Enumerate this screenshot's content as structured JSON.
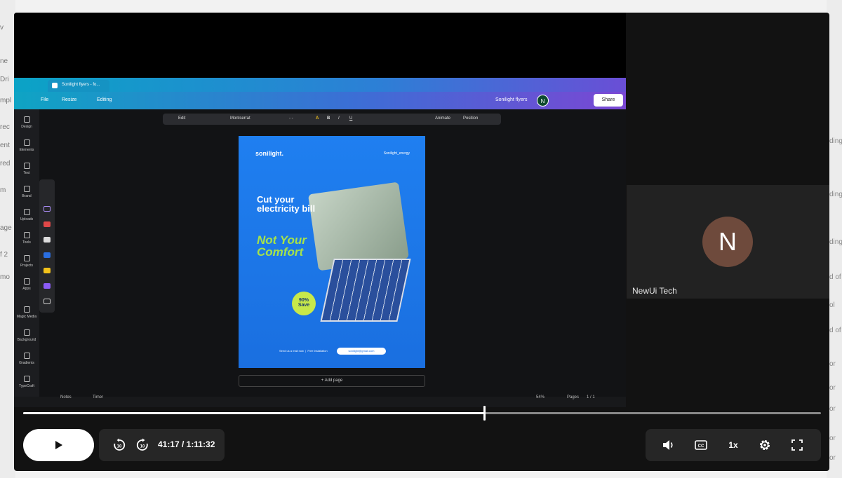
{
  "background": {
    "left_fragments": [
      "v",
      "ne",
      "Dri",
      "mpl",
      "rec",
      "ent",
      "red",
      "m",
      "age",
      "f 2",
      "mo"
    ],
    "right_fragments": [
      "ding",
      "ding",
      "ding",
      "d of",
      "ol",
      "d of",
      "or",
      "or",
      "or",
      "or",
      "or"
    ]
  },
  "participant": {
    "initial": "N",
    "name": "NewUi Tech",
    "avatar_color": "#6e4a3c"
  },
  "canva": {
    "tab_title": "Sonilight flyers - fo...",
    "menu": {
      "file": "File",
      "resize": "Resize",
      "editing": "Editing",
      "doc_title": "Sonilight flyers",
      "user_initial": "N",
      "share": "Share"
    },
    "sidebar": [
      {
        "label": "Design"
      },
      {
        "label": "Elements"
      },
      {
        "label": "Text"
      },
      {
        "label": "Brand"
      },
      {
        "label": "Uploads"
      },
      {
        "label": "Tools"
      },
      {
        "label": "Projects"
      },
      {
        "label": "Apps"
      },
      {
        "label": "Magic Media"
      },
      {
        "label": "Background"
      },
      {
        "label": "Gradients"
      },
      {
        "label": "TypeCraft"
      }
    ],
    "toolbar": {
      "edit": "Edit",
      "font": "Montserrat",
      "font_size": "- -",
      "animate": "Animate",
      "position": "Position"
    },
    "flyer": {
      "logo": "sonilight.",
      "social": "Sonilight_energy",
      "headline": "Cut your electricity bill",
      "tagline": "Not Your Comfort",
      "badge_line1": "90%",
      "badge_line2": "Save",
      "footer_left": "Send us a mail now",
      "footer_mid": "Free installation",
      "email": "sonilight@gmail.com",
      "accent": "#a6e34a"
    },
    "add_page": "+ Add page",
    "status": {
      "notes": "Notes",
      "timer": "Timer",
      "zoom": "54%",
      "pages": "Pages",
      "page_count": "1 / 1"
    }
  },
  "player": {
    "current_time": "41:17",
    "total_time": "/ 1:11:32",
    "progress": 0.578,
    "speed": "1x",
    "colors": {
      "track": "#888888",
      "fill": "#ffffff",
      "panel": "#262626"
    }
  }
}
